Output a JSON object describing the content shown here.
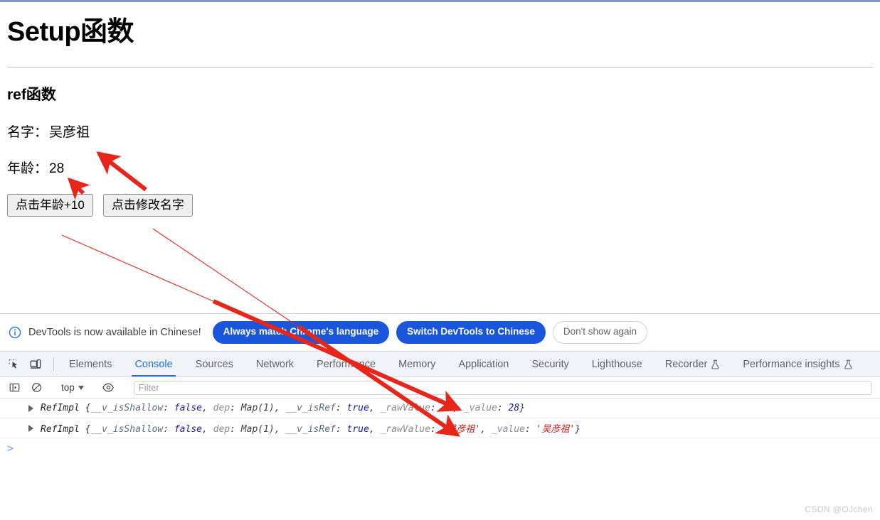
{
  "page": {
    "title": "Setup函数",
    "section_title": "ref函数",
    "fields": [
      {
        "label": "名字：",
        "value": "吴彦祖"
      },
      {
        "label": "年龄：",
        "value": "28"
      }
    ],
    "buttons": [
      {
        "label": "点击年龄+10"
      },
      {
        "label": "点击修改名字"
      }
    ]
  },
  "devtools": {
    "infobar": {
      "icon": "info-circle-icon",
      "message": "DevTools is now available in Chinese!",
      "buttons": [
        {
          "label": "Always match Chrome's language",
          "style": "primary"
        },
        {
          "label": "Switch DevTools to Chinese",
          "style": "primary"
        },
        {
          "label": "Don't show again",
          "style": "ghost"
        }
      ]
    },
    "tool_icons": [
      {
        "name": "inspect-element-icon"
      },
      {
        "name": "device-toolbar-icon"
      }
    ],
    "tabs": [
      {
        "label": "Elements",
        "active": false,
        "experiment": false
      },
      {
        "label": "Console",
        "active": true,
        "experiment": false
      },
      {
        "label": "Sources",
        "active": false,
        "experiment": false
      },
      {
        "label": "Network",
        "active": false,
        "experiment": false
      },
      {
        "label": "Performance",
        "active": false,
        "experiment": false
      },
      {
        "label": "Memory",
        "active": false,
        "experiment": false
      },
      {
        "label": "Application",
        "active": false,
        "experiment": false
      },
      {
        "label": "Security",
        "active": false,
        "experiment": false
      },
      {
        "label": "Lighthouse",
        "active": false,
        "experiment": false
      },
      {
        "label": "Recorder",
        "active": false,
        "experiment": true
      },
      {
        "label": "Performance insights",
        "active": false,
        "experiment": true
      }
    ],
    "console_toolbar": {
      "sidebar_icon": "console-sidebar-icon",
      "clear_icon": "clear-console-icon",
      "context": "top",
      "eye_icon": "live-expression-eye-icon",
      "filter_placeholder": "Filter",
      "filter_value": ""
    },
    "console_messages": [
      {
        "class_name": "RefImpl",
        "props": [
          {
            "key": "__v_isShallow",
            "value": "false",
            "type": "bool"
          },
          {
            "key": "dep",
            "value": "Map(1)",
            "type": "map"
          },
          {
            "key": "__v_isRef",
            "value": "true",
            "type": "bool"
          },
          {
            "key": "_rawValue",
            "value": "28",
            "type": "num"
          },
          {
            "key": "_value",
            "value": "28",
            "type": "num"
          }
        ]
      },
      {
        "class_name": "RefImpl",
        "props": [
          {
            "key": "__v_isShallow",
            "value": "false",
            "type": "bool"
          },
          {
            "key": "dep",
            "value": "Map(1)",
            "type": "map"
          },
          {
            "key": "__v_isRef",
            "value": "true",
            "type": "bool"
          },
          {
            "key": "_rawValue",
            "value": "'吴彦祖'",
            "type": "str"
          },
          {
            "key": "_value",
            "value": "'吴彦祖'",
            "type": "str"
          }
        ]
      }
    ],
    "prompt_symbol": ">"
  },
  "annotations": {
    "color": "#e8251b",
    "arrow_count": 4
  },
  "watermark": "CSDN @OJchen",
  "colors": {
    "accent_blue": "#1a73e8",
    "pill_blue": "#1a56db",
    "annotation_red": "#e8251b",
    "tabstrip_bg": "#f1f3f9"
  }
}
